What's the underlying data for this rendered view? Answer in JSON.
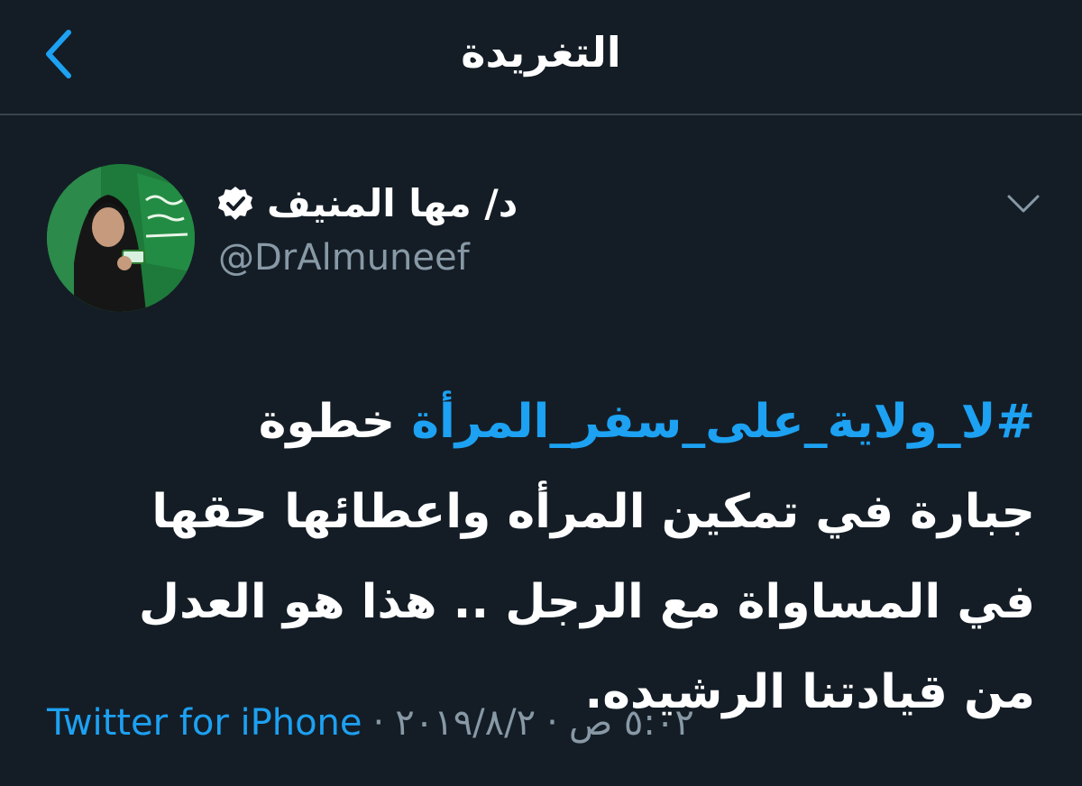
{
  "header": {
    "title": "التغريدة",
    "back_icon": "chevron-left-icon"
  },
  "author": {
    "display_name": "د/ مها المنيف",
    "handle": "@DrAlmuneef",
    "verified_icon": "verified-badge-icon",
    "menu_icon": "chevron-down-icon"
  },
  "tweet": {
    "hashtag": "#لا_ولاية_على_سفر_المرأة",
    "text": " خطوة جبارة في تمكين المرأه واعطائها حقها في المساواة مع الرجل .. هذا هو العدل من قيادتنا الرشيده."
  },
  "meta": {
    "time": "٥:٠٢ ص",
    "date": "٢٠١٩/٨/٢",
    "separator": "·",
    "source": "Twitter for iPhone"
  },
  "colors": {
    "background": "#141d26",
    "accent": "#1da1f2",
    "secondary_text": "#8899a6",
    "divider": "#38444d"
  }
}
